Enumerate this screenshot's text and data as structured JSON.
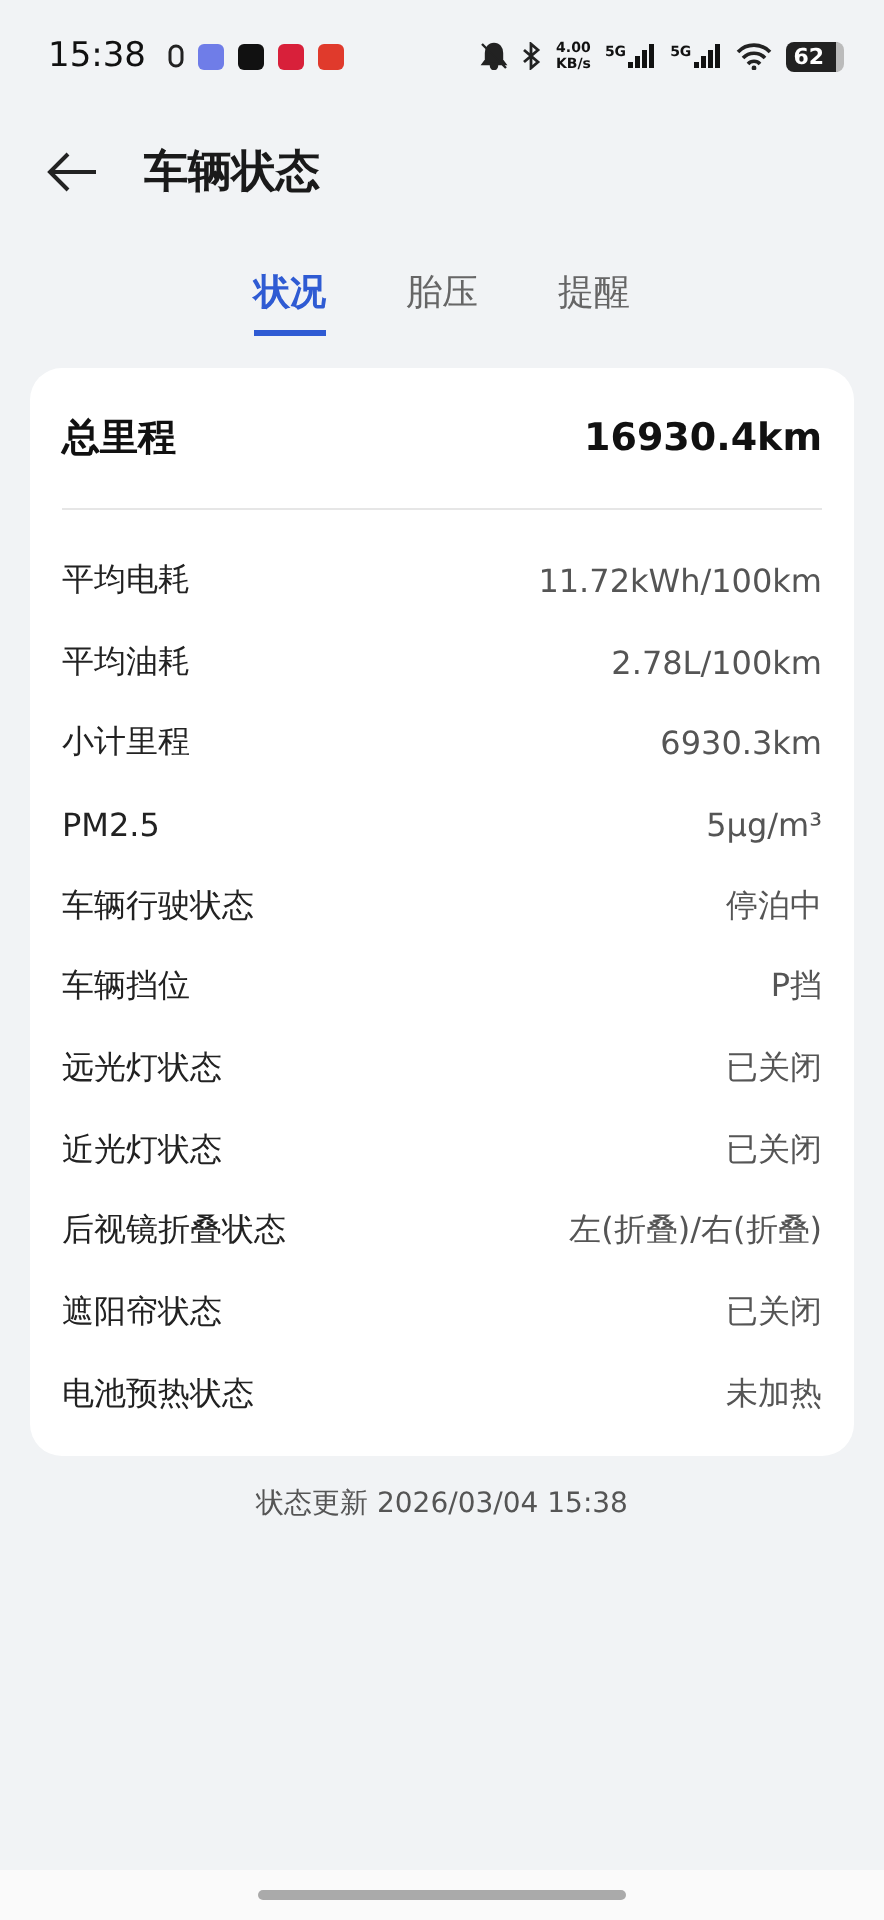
{
  "status_bar": {
    "time": "15:38",
    "network_speed": "4.00",
    "network_speed_unit": "KB/s",
    "signals": [
      {
        "label": "5G"
      },
      {
        "label": "5G"
      }
    ],
    "battery": "62"
  },
  "header": {
    "title": "车辆状态"
  },
  "tabs": [
    {
      "label": "状况",
      "selected": true
    },
    {
      "label": "胎压",
      "selected": false
    },
    {
      "label": "提醒",
      "selected": false
    }
  ],
  "summary": {
    "label": "总里程",
    "value": "16930.4km"
  },
  "rows": [
    {
      "label": "平均电耗",
      "value": "11.72kWh/100km"
    },
    {
      "label": "平均油耗",
      "value": "2.78L/100km"
    },
    {
      "label": "小计里程",
      "value": "6930.3km"
    },
    {
      "label": "PM2.5",
      "value": "5μg/m³"
    },
    {
      "label": "车辆行驶状态",
      "value": "停泊中"
    },
    {
      "label": "车辆挡位",
      "value": "P挡"
    },
    {
      "label": "远光灯状态",
      "value": "已关闭"
    },
    {
      "label": "近光灯状态",
      "value": "已关闭"
    },
    {
      "label": "后视镜折叠状态",
      "value": "左(折叠)/右(折叠)"
    },
    {
      "label": "遮阳帘状态",
      "value": "已关闭"
    },
    {
      "label": "电池预热状态",
      "value": "未加热"
    }
  ],
  "footer": "状态更新 2026/03/04 15:38"
}
